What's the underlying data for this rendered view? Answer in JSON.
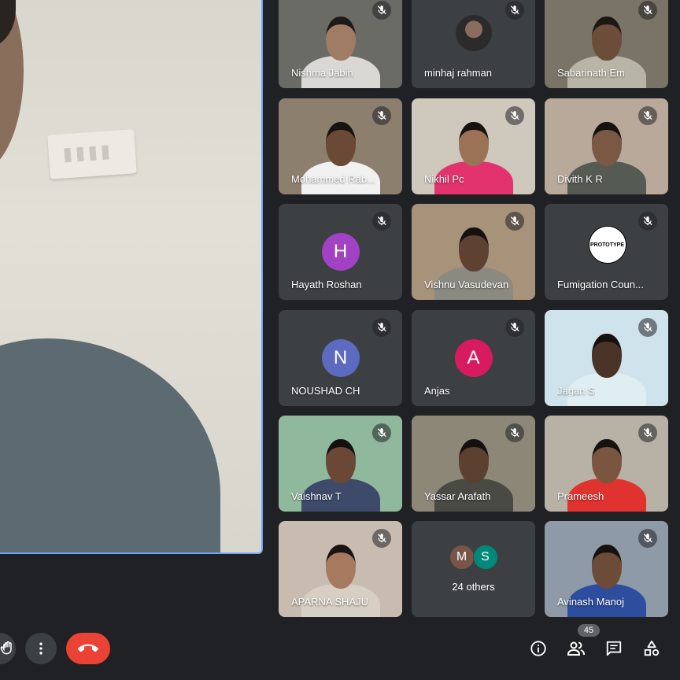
{
  "participants": [
    {
      "name": "Nishma Jabin",
      "kind": "video",
      "bg": "#6b6b66",
      "skin": "#a07c66",
      "hair": "#1e1a18",
      "shirt": "#d9d8d5"
    },
    {
      "name": "minhaj rahman",
      "kind": "photo",
      "bg": "#3c4043"
    },
    {
      "name": "Sabarinath Em",
      "kind": "video",
      "bg": "#7a7466",
      "skin": "#6b4d3a",
      "hair": "#1b1714",
      "shirt": "#b8b4a6"
    },
    {
      "name": "Mohammed Rab...",
      "kind": "video",
      "bg": "#8c7f6e",
      "skin": "#6a4a36",
      "hair": "#171310",
      "shirt": "#f1f1f1"
    },
    {
      "name": "Nikhil Pc",
      "kind": "video",
      "bg": "#cfc8bd",
      "skin": "#9b7256",
      "hair": "#16120f",
      "shirt": "#e2336f"
    },
    {
      "name": "Divith K R",
      "kind": "video",
      "bg": "#b9a99a",
      "skin": "#7a5844",
      "hair": "#16120f",
      "shirt": "#555a52"
    },
    {
      "name": "Hayath Roshan",
      "kind": "initial",
      "initial": "H",
      "color": "#a142c4"
    },
    {
      "name": "Vishnu Vasudevan",
      "kind": "video",
      "bg": "#a6937a",
      "skin": "#5e4131",
      "hair": "#141110",
      "shirt": "#8a8a82"
    },
    {
      "name": "Fumigation Coun...",
      "kind": "logo",
      "logo": "PROTOTYPE"
    },
    {
      "name": "NOUSHAD CH",
      "kind": "initial",
      "initial": "N",
      "color": "#5c6bc0"
    },
    {
      "name": "Anjas",
      "kind": "initial",
      "initial": "A",
      "color": "#d81b60"
    },
    {
      "name": "Jagan S",
      "kind": "video",
      "bg": "#cfe3ec",
      "skin": "#4a3428",
      "hair": "#15110f",
      "shirt": "#dfeef3"
    },
    {
      "name": "Vaishnav T",
      "kind": "video",
      "bg": "#8fb89d",
      "skin": "#6a4835",
      "hair": "#141110",
      "shirt": "#3d4a6a"
    },
    {
      "name": "Yassar Arafath",
      "kind": "video",
      "bg": "#8d8778",
      "skin": "#5c4030",
      "hair": "#141110",
      "shirt": "#4a4a44"
    },
    {
      "name": "Prameesh",
      "kind": "video",
      "bg": "#b8b2a6",
      "skin": "#7a5640",
      "hair": "#151210",
      "shirt": "#e0322f"
    },
    {
      "name": "APARNA SHAJU",
      "kind": "video",
      "bg": "#c8bcb0",
      "skin": "#a77a60",
      "hair": "#1a1512",
      "shirt": "#d8cfc4"
    },
    {
      "name": "24 others",
      "kind": "others",
      "initials": [
        {
          "letter": "M",
          "color": "#795548"
        },
        {
          "name": "",
          "letter": "S",
          "color": "#00897b"
        }
      ]
    },
    {
      "name": "Avinash Manoj",
      "kind": "video",
      "bg": "#8e9aa8",
      "skin": "#6c4b38",
      "hair": "#151210",
      "shirt": "#2d4e9e"
    }
  ],
  "controls": {
    "participant_count": "45"
  }
}
